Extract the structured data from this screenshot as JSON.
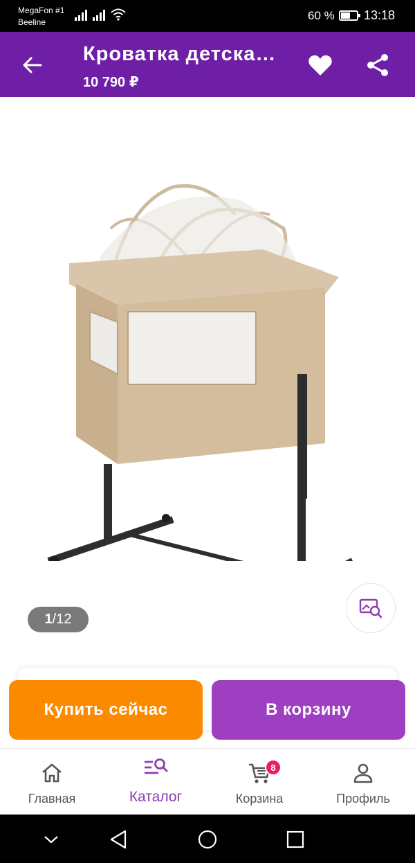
{
  "status_bar": {
    "carrier1": "MegaFon #1",
    "carrier2": "Beeline",
    "battery": "60 %",
    "time": "13:18"
  },
  "header": {
    "title": "Кроватка детская приставная",
    "price": "10 790 ₽",
    "icons": [
      "back-arrow-icon",
      "heart-icon",
      "share-icon"
    ]
  },
  "gallery": {
    "current": "1",
    "separator": " / ",
    "total": "12"
  },
  "actions": {
    "buy_now": "Купить сейчас",
    "add_to_cart": "В корзину"
  },
  "bottom_nav": {
    "items": [
      {
        "label": "Главная",
        "icon": "home-icon"
      },
      {
        "label": "Каталог",
        "icon": "catalog-search-icon",
        "active": true
      },
      {
        "label": "Корзина",
        "icon": "cart-icon",
        "badge": "8"
      },
      {
        "label": "Профиль",
        "icon": "profile-icon"
      }
    ]
  },
  "colors": {
    "app_bar": "#6f1fa6",
    "buy_button": "#fb8a00",
    "cart_button": "#9d3fc0",
    "active_nav": "#8e3cb5",
    "badge": "#e91e63"
  }
}
